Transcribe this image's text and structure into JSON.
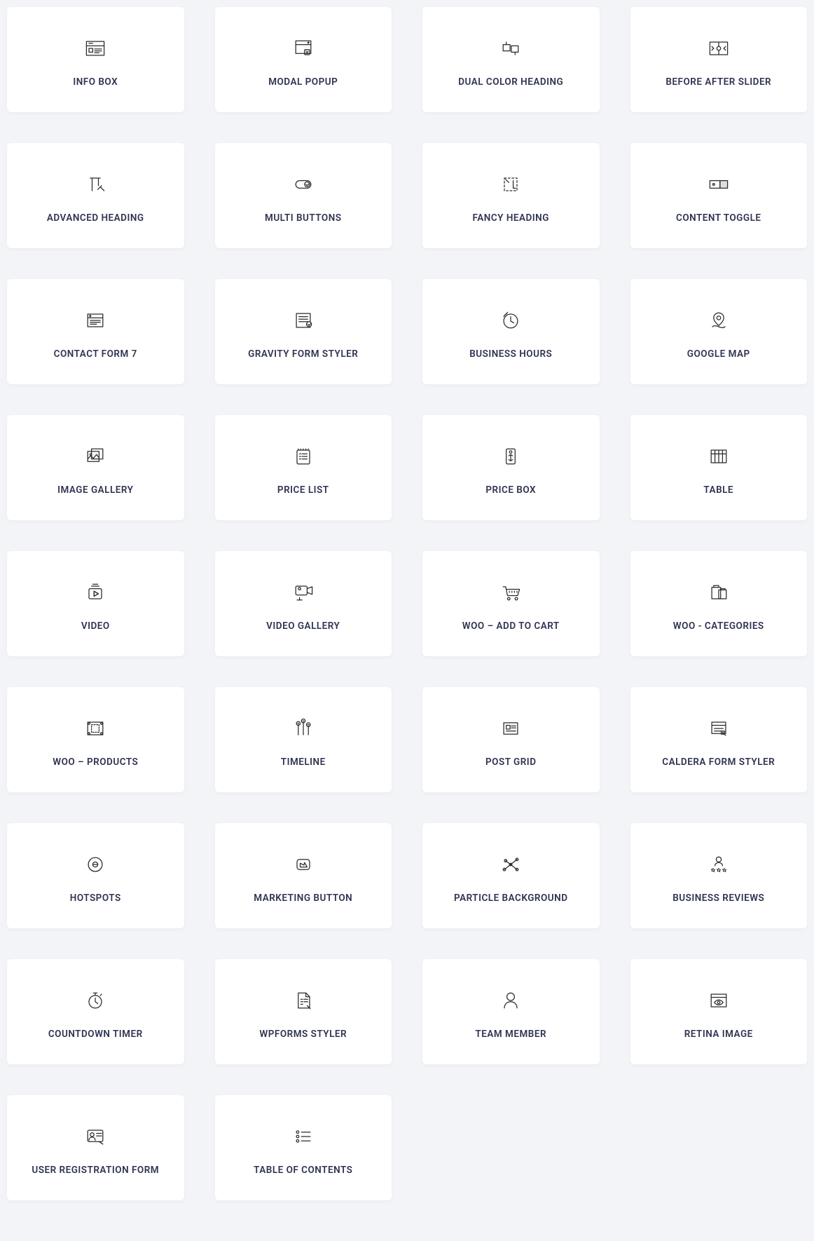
{
  "grid": {
    "items": [
      {
        "label": "INFO BOX",
        "icon": "info-box-icon"
      },
      {
        "label": "MODAL POPUP",
        "icon": "modal-popup-icon"
      },
      {
        "label": "DUAL COLOR HEADING",
        "icon": "dual-color-heading-icon"
      },
      {
        "label": "BEFORE AFTER SLIDER",
        "icon": "before-after-slider-icon"
      },
      {
        "label": "ADVANCED HEADING",
        "icon": "advanced-heading-icon"
      },
      {
        "label": "MULTI BUTTONS",
        "icon": "multi-buttons-icon"
      },
      {
        "label": "FANCY HEADING",
        "icon": "fancy-heading-icon"
      },
      {
        "label": "CONTENT TOGGLE",
        "icon": "content-toggle-icon"
      },
      {
        "label": "CONTACT FORM 7",
        "icon": "contact-form-7-icon"
      },
      {
        "label": "GRAVITY FORM STYLER",
        "icon": "gravity-form-styler-icon"
      },
      {
        "label": "BUSINESS HOURS",
        "icon": "business-hours-icon"
      },
      {
        "label": "GOOGLE MAP",
        "icon": "google-map-icon"
      },
      {
        "label": "IMAGE GALLERY",
        "icon": "image-gallery-icon"
      },
      {
        "label": "PRICE LIST",
        "icon": "price-list-icon"
      },
      {
        "label": "PRICE BOX",
        "icon": "price-box-icon"
      },
      {
        "label": "TABLE",
        "icon": "table-icon"
      },
      {
        "label": "VIDEO",
        "icon": "video-icon"
      },
      {
        "label": "VIDEO GALLERY",
        "icon": "video-gallery-icon"
      },
      {
        "label": "WOO – ADD TO CART",
        "icon": "woo-add-to-cart-icon"
      },
      {
        "label": "WOO - CATEGORIES",
        "icon": "woo-categories-icon"
      },
      {
        "label": "WOO – PRODUCTS",
        "icon": "woo-products-icon"
      },
      {
        "label": "TIMELINE",
        "icon": "timeline-icon"
      },
      {
        "label": "POST GRID",
        "icon": "post-grid-icon"
      },
      {
        "label": "CALDERA FORM STYLER",
        "icon": "caldera-form-styler-icon"
      },
      {
        "label": "HOTSPOTS",
        "icon": "hotspots-icon"
      },
      {
        "label": "MARKETING BUTTON",
        "icon": "marketing-button-icon"
      },
      {
        "label": "PARTICLE BACKGROUND",
        "icon": "particle-background-icon"
      },
      {
        "label": "BUSINESS REVIEWS",
        "icon": "business-reviews-icon"
      },
      {
        "label": "COUNTDOWN TIMER",
        "icon": "countdown-timer-icon"
      },
      {
        "label": "WPFORMS STYLER",
        "icon": "wpforms-styler-icon"
      },
      {
        "label": "TEAM MEMBER",
        "icon": "team-member-icon"
      },
      {
        "label": "RETINA IMAGE",
        "icon": "retina-image-icon"
      },
      {
        "label": "USER REGISTRATION FORM",
        "icon": "user-registration-form-icon"
      },
      {
        "label": "TABLE OF CONTENTS",
        "icon": "table-of-contents-icon"
      }
    ]
  }
}
